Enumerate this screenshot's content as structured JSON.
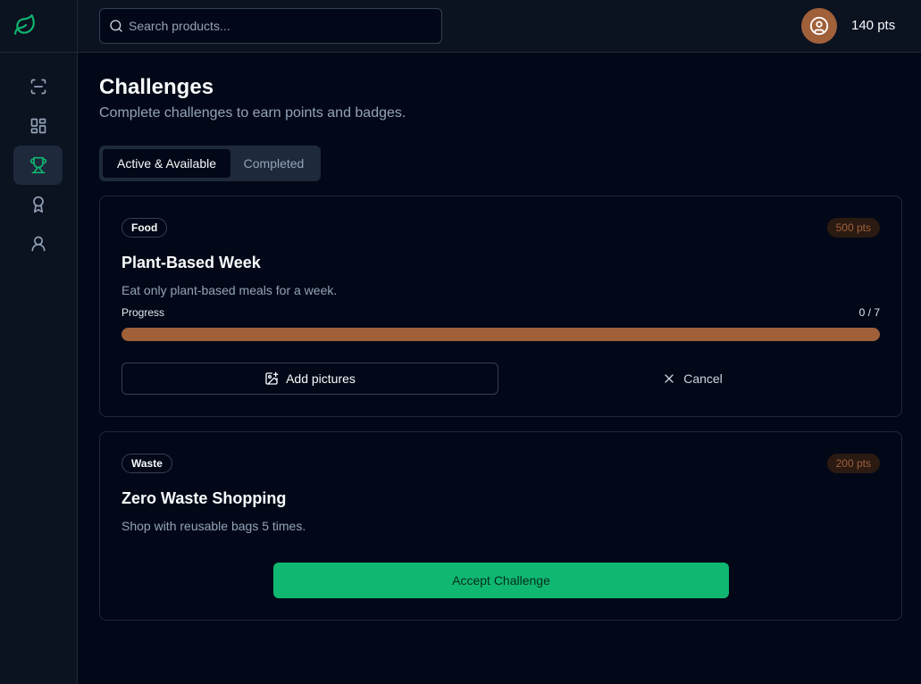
{
  "app": {
    "search_placeholder": "Search products...",
    "points": "140 pts",
    "accent_color": "#10b771",
    "brand_brown": "#a0603a"
  },
  "sidebar": {
    "items": [
      {
        "name": "scan-icon",
        "active": false
      },
      {
        "name": "dashboard-icon",
        "active": false
      },
      {
        "name": "trophy-icon",
        "active": true
      },
      {
        "name": "award-icon",
        "active": false
      },
      {
        "name": "user-icon",
        "active": false
      }
    ]
  },
  "page": {
    "title": "Challenges",
    "subtitle": "Complete challenges to earn points and badges."
  },
  "tabs": [
    {
      "label": "Active & Available",
      "active": true
    },
    {
      "label": "Completed",
      "active": false
    }
  ],
  "challenges": [
    {
      "category": "Food",
      "points": "500 pts",
      "title": "Plant-Based Week",
      "description": "Eat only plant-based meals for a week.",
      "progress_label": "Progress",
      "progress_value": "0 / 7",
      "progress_current": 0,
      "progress_total": 7,
      "add_label": "Add pictures",
      "cancel_label": "Cancel"
    },
    {
      "category": "Waste",
      "points": "200 pts",
      "title": "Zero Waste Shopping",
      "description": "Shop with reusable bags 5 times.",
      "accept_label": "Accept Challenge"
    }
  ]
}
